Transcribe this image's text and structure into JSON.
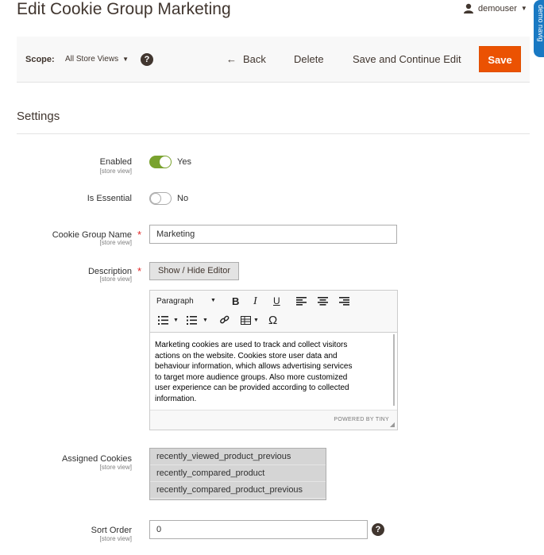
{
  "page": {
    "title": "Edit Cookie Group Marketing"
  },
  "user": {
    "name": "demouser"
  },
  "demo_nav": {
    "label": "demo navig"
  },
  "action_bar": {
    "scope_label": "Scope:",
    "scope_value": "All Store Views",
    "back_label": "Back",
    "delete_label": "Delete",
    "save_continue_label": "Save and Continue Edit",
    "save_label": "Save"
  },
  "section": {
    "title": "Settings"
  },
  "fields": {
    "enabled": {
      "label": "Enabled",
      "scope": "[store view]",
      "value_text": "Yes",
      "on": true
    },
    "essential": {
      "label": "Is Essential",
      "value_text": "No",
      "on": false
    },
    "name": {
      "label": "Cookie Group Name",
      "scope": "[store view]",
      "value": "Marketing"
    },
    "description": {
      "label": "Description",
      "scope": "[store view]",
      "toggle_label": "Show / Hide Editor",
      "format": "Paragraph",
      "content": "Marketing cookies are used to track and collect visitors\nactions on the website. Cookies store user data and\nbehaviour information, which allows advertising services\nto target more audience groups. Also more customized\nuser experience can be provided according to collected\ninformation.",
      "powered": "POWERED BY TINY"
    },
    "assigned": {
      "label": "Assigned Cookies",
      "scope": "[store view]",
      "options": [
        "recently_viewed_product_previous",
        "recently_compared_product",
        "recently_compared_product_previous"
      ]
    },
    "sort_order": {
      "label": "Sort Order",
      "scope": "[store view]",
      "value": "0"
    }
  },
  "colors": {
    "accent": "#eb5202",
    "toggle_on": "#79a22e"
  }
}
